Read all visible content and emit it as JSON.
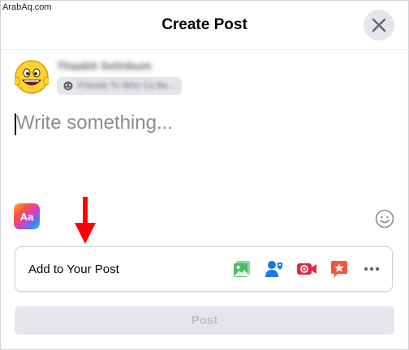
{
  "watermark": "ArabAq.com",
  "header": {
    "title": "Create Post"
  },
  "user": {
    "name": "Thaabit Selinbum",
    "audience_label": "Friends To Who Ca Be..."
  },
  "composer": {
    "placeholder": "Write something..."
  },
  "toolbar": {
    "background_icon_label": "Aa"
  },
  "add_to_post": {
    "label": "Add to Your Post",
    "tools": [
      "photo-video",
      "tag-people",
      "live-video",
      "check-in",
      "more"
    ]
  },
  "post_button": {
    "label": "Post"
  },
  "colors": {
    "photo": "#45bd62",
    "tag": "#1877f2",
    "live": "#e42645",
    "checkin": "#f5533d",
    "arrow": "#ff0000",
    "disabled_btn": "#e4e6eb",
    "disabled_text": "#bcc0c4"
  }
}
